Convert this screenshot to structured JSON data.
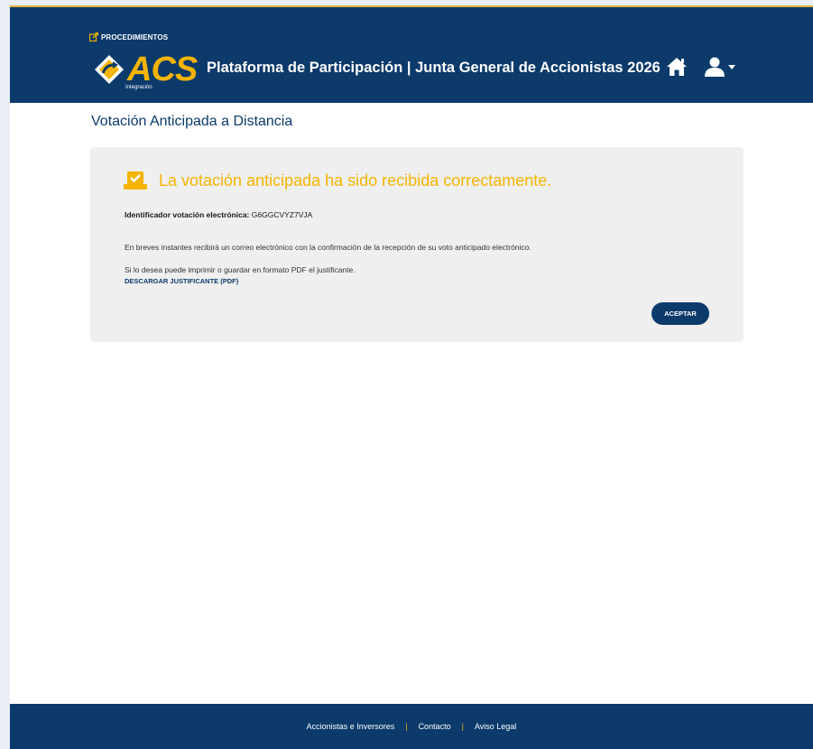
{
  "header": {
    "procedures_link": "PROCEDIMIENTOS",
    "logo_text": "ACS",
    "logo_subtext": "Integración",
    "platform_title": "Plataforma de Participación | Junta General de Accionistas 2026",
    "icons": [
      "home-icon",
      "user-icon",
      "caret-down-icon"
    ]
  },
  "page": {
    "title": "Votación Anticipada a Distancia"
  },
  "panel": {
    "success_message": "La votación anticipada ha sido recibida correctamente.",
    "identifier_label": "Identificador votación electrónica:",
    "identifier_value": "G6GGCVYZ7VJA",
    "email_notice": "En breves instantes recibirá un correo electrónico con la confirmación de la recepción de su voto anticipado electrónico.",
    "print_notice": "Si lo desea puede imprimir o guardar en formato PDF el justificante.",
    "download_link": "DESCARGAR JUSTIFICANTE (PDF)",
    "accept_button": "ACEPTAR"
  },
  "footer": {
    "links": [
      "Accionistas e Inversores",
      "Contacto",
      "Aviso Legal"
    ],
    "separator": "|"
  },
  "colors": {
    "primary": "#0b3a6b",
    "accent": "#f4b400",
    "panel_bg": "#efefef"
  }
}
